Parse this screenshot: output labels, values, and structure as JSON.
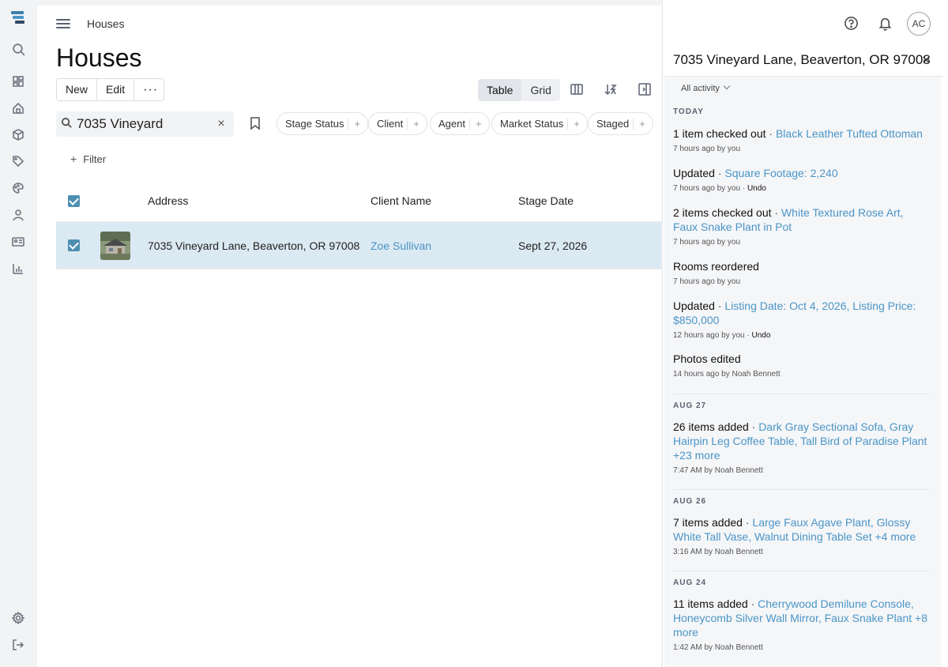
{
  "app": {
    "breadcrumb": "Houses",
    "page_title": "Houses"
  },
  "toolbar": {
    "new_label": "New",
    "edit_label": "Edit",
    "more_label": "···",
    "view_table": "Table",
    "view_grid": "Grid"
  },
  "search": {
    "value": "7035 Vineyard",
    "clear_label": "×"
  },
  "chips": [
    "Stage Status",
    "Client",
    "Agent",
    "Market Status",
    "Staged"
  ],
  "chip_plus": "+",
  "filter": {
    "plus": "+",
    "label": "Filter"
  },
  "table": {
    "headers": {
      "address": "Address",
      "client_name": "Client Name",
      "stage_date": "Stage Date"
    },
    "rows": [
      {
        "address": "7035 Vineyard Lane, Beaverton, OR 97008",
        "client": "Zoe Sullivan",
        "stage_date": "Sept 27, 2026"
      }
    ]
  },
  "header": {
    "avatar_initials": "AC"
  },
  "panel": {
    "title": "7035 Vineyard Lane, Beaverton, OR 97008",
    "close": "×",
    "all_activity": "All activity",
    "sections": {
      "today": "TODAY",
      "aug27": "AUG 27",
      "aug26": "AUG 26",
      "aug24": "AUG 24"
    },
    "activities": [
      {
        "action": "1 item checked out",
        "dot": "·",
        "detail": "Black Leather Tufted Ottoman",
        "meta": "7 hours ago  by you"
      },
      {
        "action": "Updated",
        "dot": "·",
        "detail": "Square Footage: 2,240",
        "meta": "7 hours ago  by you  ·",
        "undo": "Undo"
      },
      {
        "action": "2 items checked out",
        "dot": "·",
        "detail": "White Textured Rose Art, Faux Snake Plant in Pot",
        "meta": "7 hours ago  by you"
      },
      {
        "action": "Rooms reordered",
        "dot": "",
        "detail": "",
        "meta": "7 hours ago  by you"
      },
      {
        "action": "Updated",
        "dot": "·",
        "detail": "Listing Date: Oct 4, 2026, Listing Price: $850,000",
        "meta": "12 hours ago  by you  ·",
        "undo": "Undo"
      },
      {
        "action": "Photos edited",
        "dot": "",
        "detail": "",
        "meta": "14 hours ago  by Noah Bennett"
      },
      {
        "action": "26 items added",
        "dot": "·",
        "detail": "Dark Gray Sectional Sofa, Gray Hairpin Leg Coffee Table, Tall Bird of Paradise Plant +23 more",
        "meta": "7:47 AM  by Noah Bennett"
      },
      {
        "action": "7 items added",
        "dot": "·",
        "detail": "Large Faux Agave Plant, Glossy White Tall Vase, Walnut Dining Table Set +4 more",
        "meta": "3:16 AM  by Noah Bennett"
      },
      {
        "action": "11 items added",
        "dot": "·",
        "detail": "Cherrywood Demilune Console, Honeycomb Silver Wall Mirror, Faux Snake Plant +8 more",
        "meta": "1:42 AM  by Noah Bennett"
      }
    ]
  },
  "colors": {
    "accent": "#4a95c7",
    "selected_row": "#dbe9f2",
    "checkbox": "#4d8fb2"
  }
}
